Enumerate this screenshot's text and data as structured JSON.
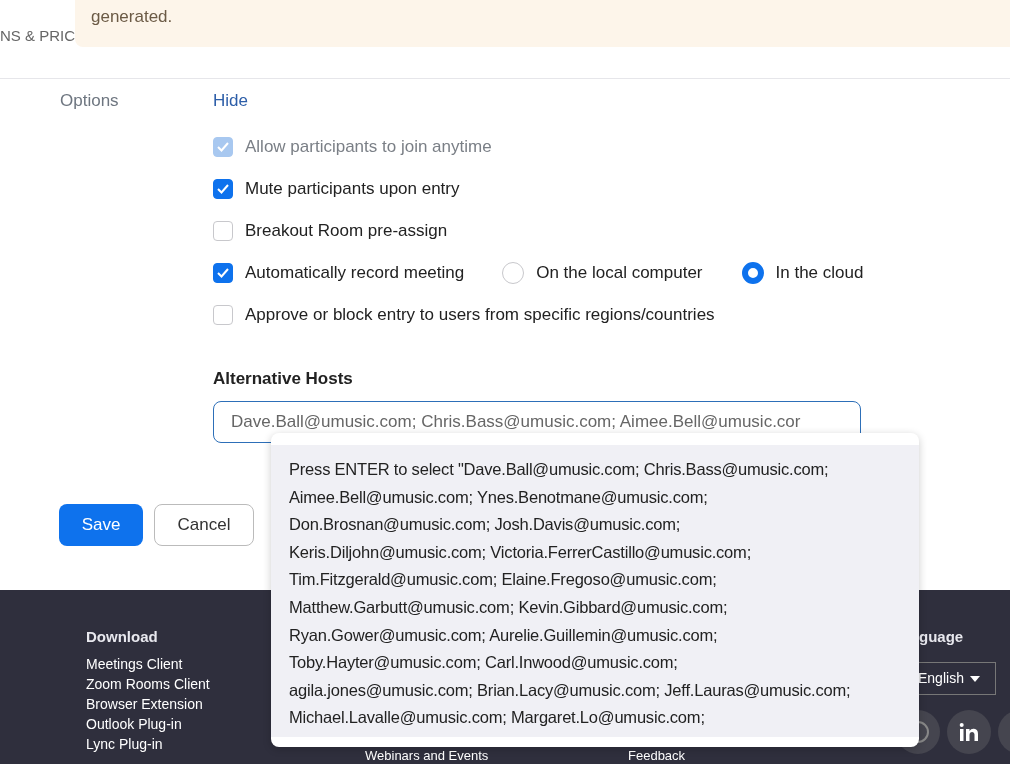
{
  "nav": {
    "label": "NS & PRIC"
  },
  "banner": {
    "text": "generated."
  },
  "options": {
    "label": "Options",
    "toggle": "Hide",
    "items": [
      {
        "kind": "checkbox",
        "label": "Allow participants to join anytime",
        "checked": true,
        "disabled": true
      },
      {
        "kind": "checkbox",
        "label": "Mute participants upon entry",
        "checked": true,
        "disabled": false
      },
      {
        "kind": "checkbox",
        "label": "Breakout Room pre-assign",
        "checked": false,
        "disabled": false
      },
      {
        "kind": "checkbox",
        "label": "Automatically record meeting",
        "checked": true,
        "disabled": false,
        "choices": [
          {
            "label": "On the local computer",
            "selected": false
          },
          {
            "label": "In the cloud",
            "selected": true
          }
        ]
      },
      {
        "kind": "checkbox",
        "label": "Approve or block entry to users from specific regions/countries",
        "checked": false,
        "disabled": false
      }
    ]
  },
  "alternative_hosts": {
    "label": "Alternative Hosts",
    "value": "Dave.Ball@umusic.com; Chris.Bass@umusic.com; Aimee.Bell@umusic.cor",
    "suggestion": {
      "lines": [
        "Press ENTER to select \"Dave.Ball@umusic.com; Chris.Bass@umusic.com;",
        "Aimee.Bell@umusic.com; Ynes.Benotmane@umusic.com;",
        "Don.Brosnan@umusic.com; Josh.Davis@umusic.com;",
        "Keris.Diljohn@umusic.com; Victoria.FerrerCastillo@umusic.com;",
        "Tim.Fitzgerald@umusic.com; Elaine.Fregoso@umusic.com;",
        "Matthew.Garbutt@umusic.com; Kevin.Gibbard@umusic.com;",
        "Ryan.Gower@umusic.com; Aurelie.Guillemin@umusic.com;",
        "Toby.Hayter@umusic.com; Carl.Inwood@umusic.com;",
        "agila.jones@umusic.com; Brian.Lacy@umusic.com; Jeff.Lauras@umusic.com;",
        "Michael.Lavalle@umusic.com; Margaret.Lo@umusic.com;"
      ]
    }
  },
  "buttons": [
    {
      "kind": "primary",
      "label": "Save"
    },
    {
      "kind": "secondary",
      "label": "Cancel"
    }
  ],
  "footer": {
    "download": {
      "heading": "Download",
      "links": [
        "Meetings Client",
        "Zoom Rooms Client",
        "Browser Extension",
        "Outlook Plug-in",
        "Lync Plug-in"
      ]
    },
    "partial_links": [
      "Webinars and Events",
      "Feedback"
    ],
    "language": {
      "heading": "guage",
      "value": "English"
    }
  }
}
